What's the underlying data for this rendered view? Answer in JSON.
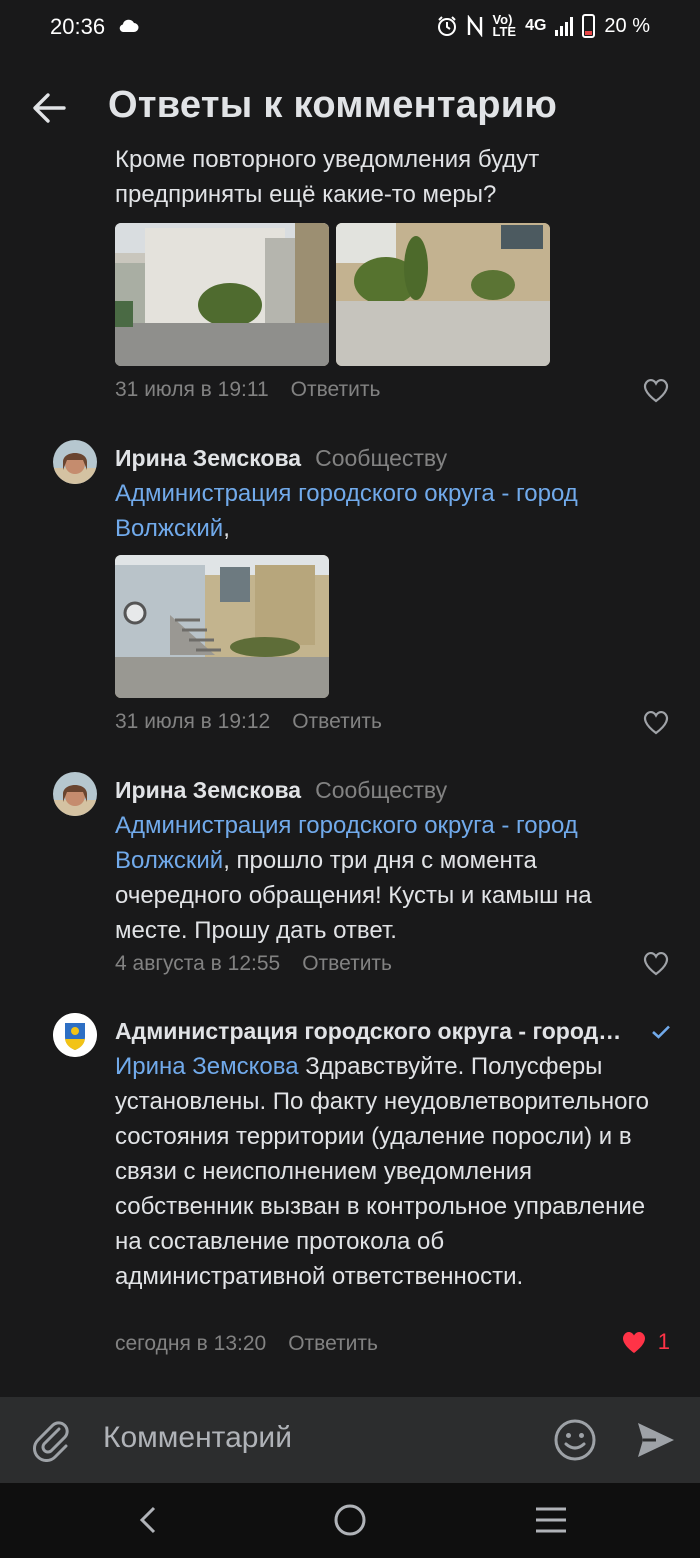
{
  "status": {
    "time": "20:36",
    "battery": "20 %",
    "network": "4G",
    "volte_top": "Vo)",
    "volte_bottom": "LTE"
  },
  "header": {
    "title": "Ответы к комментарию"
  },
  "comments": [
    {
      "text": "Кроме повторного уведомления будут предприняты ещё какие-то меры?",
      "date": "31 июля в 19:11",
      "reply_label": "Ответить"
    },
    {
      "author": "Ирина Земскова",
      "to": "Сообществу",
      "mention": "Администрация городского округа - город Волжский",
      "text": ",",
      "date": "31 июля в 19:12",
      "reply_label": "Ответить"
    },
    {
      "author": "Ирина Земскова",
      "to": "Сообществу",
      "mention": "Администрация городского округа - город Волжский",
      "text": ", прошло три дня с момента очередного обращения! Кусты и камыш на месте. Прошу дать ответ.",
      "date": "4 августа в 12:55",
      "reply_label": "Ответить"
    },
    {
      "author": "Администрация городского округа - город…",
      "mention": "Ирина Земскова",
      "text": " Здравствуйте. Полусферы установлены. По факту неудовлетворительного состояния территории (удаление поросли) и в связи с неисполнением уведомления собственник вызван в контрольное управление на составление протокола об административной ответственности.",
      "date": "сегодня в 13:20",
      "reply_label": "Ответить",
      "likes": "1"
    }
  ],
  "composer": {
    "placeholder": "Комментарий"
  },
  "colors": {
    "background": "#19191a",
    "link": "#71aaeb",
    "like": "#ff3347",
    "muted": "#828282"
  }
}
